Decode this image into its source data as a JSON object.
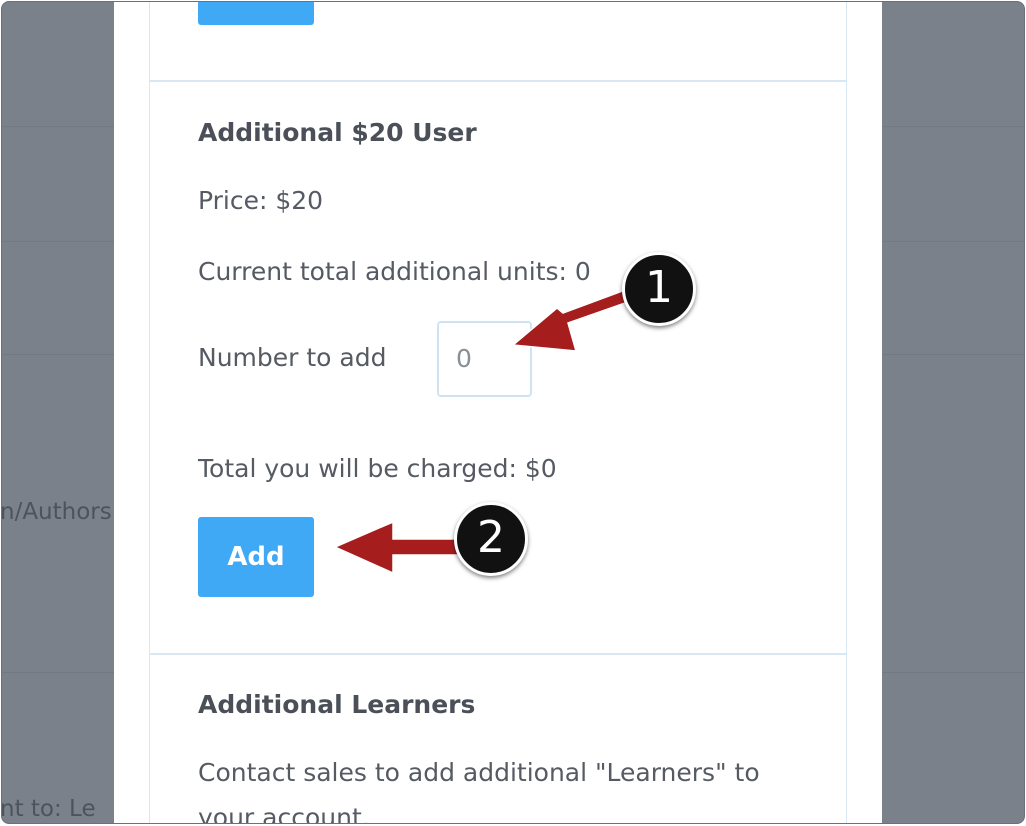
{
  "background": {
    "snippet_1": "n/Authors",
    "snippet_2": "nt to: Le"
  },
  "top_section": {
    "button_label": ""
  },
  "additional_user": {
    "title": "Additional $20 User",
    "price": "Price: $20",
    "current_units": "Current total additional units: 0",
    "number_label": "Number to add",
    "number_value": "0",
    "total": "Total you will be charged: $0",
    "add_label": "Add"
  },
  "additional_learners": {
    "title": "Additional Learners",
    "line1": "Contact sales to add additional \"Learners\" to",
    "line2": "your account."
  },
  "callouts": {
    "first": "1",
    "second": "2"
  },
  "colors": {
    "accent": "#40a9f5",
    "arrow": "#a51d1d",
    "overlay": "#7b818b"
  }
}
